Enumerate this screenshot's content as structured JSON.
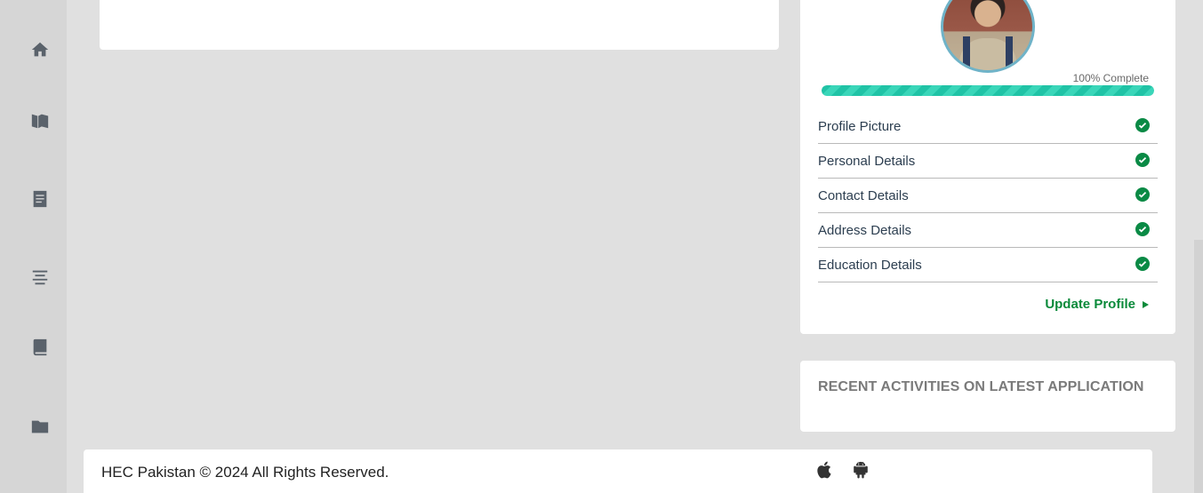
{
  "sidebar": {
    "icons": [
      "home-icon",
      "map-book-icon",
      "document-icon",
      "list-icon",
      "book-icon",
      "folder-icon"
    ]
  },
  "profile": {
    "completion_label": "100% Complete",
    "completion_fraction": 1.0,
    "checklist": [
      {
        "label": "Profile Picture",
        "done": true
      },
      {
        "label": "Personal Details",
        "done": true
      },
      {
        "label": "Contact Details",
        "done": true
      },
      {
        "label": "Address Details",
        "done": true
      },
      {
        "label": "Education Details",
        "done": true
      }
    ],
    "update_label": "Update Profile"
  },
  "activity": {
    "title": "RECENT ACTIVITIES ON LATEST APPLICATION"
  },
  "footer": {
    "copyright": "HEC Pakistan © 2024 All Rights Reserved.",
    "store_icons": [
      "apple-icon",
      "android-icon"
    ]
  },
  "colors": {
    "accent_green": "#0a8a3a",
    "progress_teal": "#20c3a6",
    "background": "#e0e0e0"
  }
}
